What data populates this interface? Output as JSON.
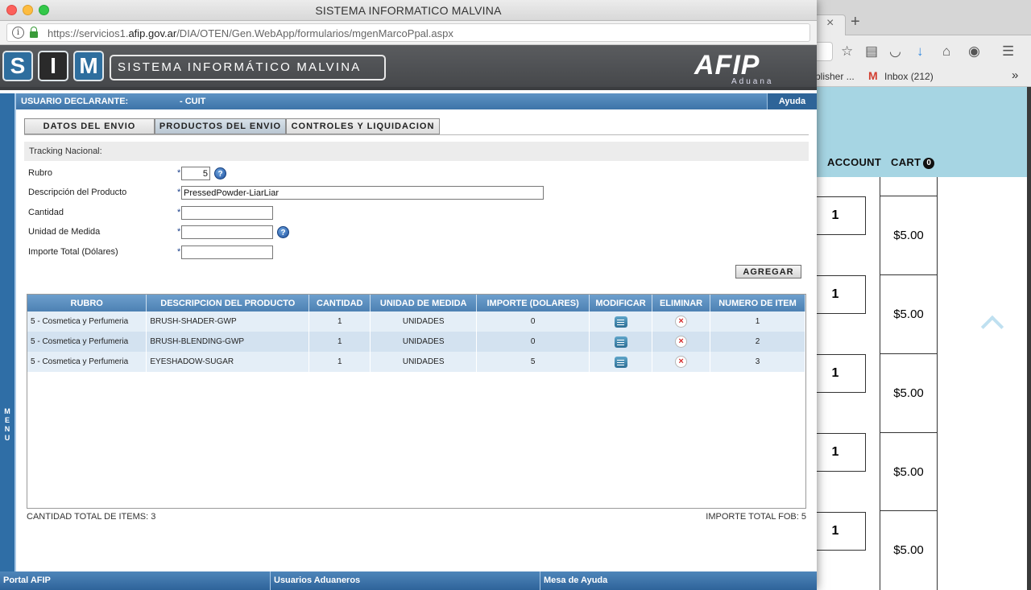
{
  "window": {
    "title": "SISTEMA INFORMATICO MALVINA",
    "url_prefix": "https://servicios1.",
    "url_domain": "afip.gov.ar",
    "url_path": "/DIA/OTEN/Gen.WebApp/formularios/mgenMarcoPpal.aspx"
  },
  "header": {
    "sim_letters": [
      "S",
      "I",
      "M"
    ],
    "sim_title": "SISTEMA INFORMÁTICO MALVINA",
    "afip_logo": "AFIP",
    "aduana": "Aduana"
  },
  "menu_label": "MENU",
  "userbar": {
    "label": "USUARIO DECLARANTE:",
    "cuit": "- CUIT",
    "help": "Ayuda"
  },
  "tabs": [
    {
      "label": "DATOS DEL ENVIO"
    },
    {
      "label": "PRODUCTOS DEL ENVIO"
    },
    {
      "label": "CONTROLES Y LIQUIDACION"
    }
  ],
  "form": {
    "tracking_label": "Tracking Nacional:",
    "required_mark": "*",
    "rubro_label": "Rubro",
    "rubro_value": "5",
    "descripcion_label": "Descripción del Producto",
    "descripcion_value": "PressedPowder-LiarLiar",
    "cantidad_label": "Cantidad",
    "cantidad_value": "",
    "unidad_label": "Unidad de Medida",
    "unidad_value": "",
    "importe_label": "Importe Total (Dólares)",
    "importe_value": "",
    "help_glyph": "?",
    "add_button": "AGREGAR"
  },
  "grid": {
    "headers": [
      "RUBRO",
      "DESCRIPCION DEL PRODUCTO",
      "CANTIDAD",
      "UNIDAD DE MEDIDA",
      "IMPORTE (DOLARES)",
      "MODIFICAR",
      "ELIMINAR",
      "NUMERO DE ITEM"
    ],
    "rows": [
      {
        "rubro": "5 - Cosmetica y Perfumeria",
        "descripcion": "BRUSH-SHADER-GWP",
        "cantidad": "1",
        "unidad": "UNIDADES",
        "importe": "0",
        "item": "1"
      },
      {
        "rubro": "5 - Cosmetica y Perfumeria",
        "descripcion": "BRUSH-BLENDING-GWP",
        "cantidad": "1",
        "unidad": "UNIDADES",
        "importe": "0",
        "item": "2"
      },
      {
        "rubro": "5 - Cosmetica y Perfumeria",
        "descripcion": "EYESHADOW-SUGAR",
        "cantidad": "1",
        "unidad": "UNIDADES",
        "importe": "5",
        "item": "3"
      }
    ],
    "delete_glyph": "×"
  },
  "totals": {
    "items": "CANTIDAD TOTAL DE ITEMS: 3",
    "fob": "IMPORTE TOTAL FOB: 5"
  },
  "footer": [
    "Portal AFIP",
    "Usuarios Aduaneros",
    "Mesa de Ayuda"
  ],
  "background_browser": {
    "bookmark_publisher": "blisher ...",
    "bookmark_gmail_glyph": "M",
    "bookmark_inbox": "Inbox (212)",
    "overflow_glyph": "»",
    "close_glyph": "×",
    "newtab_glyph": "+",
    "nav_account": "ACCOUNT",
    "nav_cart": "CART",
    "cart_count": "0",
    "quantities": [
      "1",
      "1",
      "1",
      "1",
      "1"
    ],
    "prices": [
      "$5.00",
      "$5.00",
      "$5.00",
      "$5.00",
      "$5.00"
    ]
  },
  "colors": {
    "accent_blue": "#3d74a8",
    "header_dark": "#4f5154",
    "bg_site_header": "#a6d5e3"
  }
}
